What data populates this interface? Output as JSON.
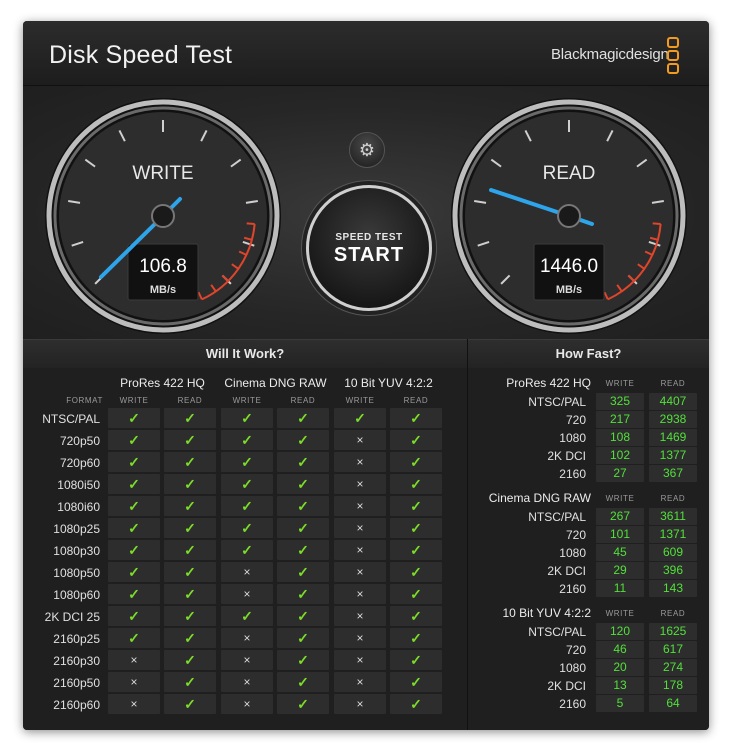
{
  "window": {
    "title": "Disk Speed Test",
    "brand": "Blackmagicdesign",
    "close_glyph": "×"
  },
  "gauges": {
    "write": {
      "label": "WRITE",
      "value": "106.8",
      "unit": "MB/s"
    },
    "read": {
      "label": "READ",
      "value": "1446.0",
      "unit": "MB/s"
    }
  },
  "settings_icon": "gear-icon",
  "start": {
    "line1": "SPEED TEST",
    "line2": "START"
  },
  "will_it_work": {
    "title": "Will It Work?",
    "format_label": "FORMAT",
    "groups": [
      "ProRes 422 HQ",
      "Cinema DNG RAW",
      "10 Bit YUV 4:2:2"
    ],
    "write_label": "WRITE",
    "read_label": "READ",
    "ok_glyph": "✓",
    "no_glyph": "×",
    "rows": [
      {
        "format": "NTSC/PAL",
        "v": [
          1,
          1,
          1,
          1,
          1,
          1
        ]
      },
      {
        "format": "720p50",
        "v": [
          1,
          1,
          1,
          1,
          0,
          1
        ]
      },
      {
        "format": "720p60",
        "v": [
          1,
          1,
          1,
          1,
          0,
          1
        ]
      },
      {
        "format": "1080i50",
        "v": [
          1,
          1,
          1,
          1,
          0,
          1
        ]
      },
      {
        "format": "1080i60",
        "v": [
          1,
          1,
          1,
          1,
          0,
          1
        ]
      },
      {
        "format": "1080p25",
        "v": [
          1,
          1,
          1,
          1,
          0,
          1
        ]
      },
      {
        "format": "1080p30",
        "v": [
          1,
          1,
          1,
          1,
          0,
          1
        ]
      },
      {
        "format": "1080p50",
        "v": [
          1,
          1,
          0,
          1,
          0,
          1
        ]
      },
      {
        "format": "1080p60",
        "v": [
          1,
          1,
          0,
          1,
          0,
          1
        ]
      },
      {
        "format": "2K DCI 25",
        "v": [
          1,
          1,
          1,
          1,
          0,
          1
        ]
      },
      {
        "format": "2160p25",
        "v": [
          1,
          1,
          0,
          1,
          0,
          1
        ]
      },
      {
        "format": "2160p30",
        "v": [
          0,
          1,
          0,
          1,
          0,
          1
        ]
      },
      {
        "format": "2160p50",
        "v": [
          0,
          1,
          0,
          1,
          0,
          1
        ]
      },
      {
        "format": "2160p60",
        "v": [
          0,
          1,
          0,
          1,
          0,
          1
        ]
      }
    ]
  },
  "how_fast": {
    "title": "How Fast?",
    "write_label": "WRITE",
    "read_label": "READ",
    "groups": [
      {
        "name": "ProRes 422 HQ",
        "rows": [
          {
            "format": "NTSC/PAL",
            "write": "325",
            "read": "4407"
          },
          {
            "format": "720",
            "write": "217",
            "read": "2938"
          },
          {
            "format": "1080",
            "write": "108",
            "read": "1469"
          },
          {
            "format": "2K DCI",
            "write": "102",
            "read": "1377"
          },
          {
            "format": "2160",
            "write": "27",
            "read": "367"
          }
        ]
      },
      {
        "name": "Cinema DNG RAW",
        "rows": [
          {
            "format": "NTSC/PAL",
            "write": "267",
            "read": "3611"
          },
          {
            "format": "720",
            "write": "101",
            "read": "1371"
          },
          {
            "format": "1080",
            "write": "45",
            "read": "609"
          },
          {
            "format": "2K DCI",
            "write": "29",
            "read": "396"
          },
          {
            "format": "2160",
            "write": "11",
            "read": "143"
          }
        ]
      },
      {
        "name": "10 Bit YUV 4:2:2",
        "rows": [
          {
            "format": "NTSC/PAL",
            "write": "120",
            "read": "1625"
          },
          {
            "format": "720",
            "write": "46",
            "read": "617"
          },
          {
            "format": "1080",
            "write": "20",
            "read": "274"
          },
          {
            "format": "2K DCI",
            "write": "13",
            "read": "178"
          },
          {
            "format": "2160",
            "write": "5",
            "read": "64"
          }
        ]
      }
    ]
  }
}
